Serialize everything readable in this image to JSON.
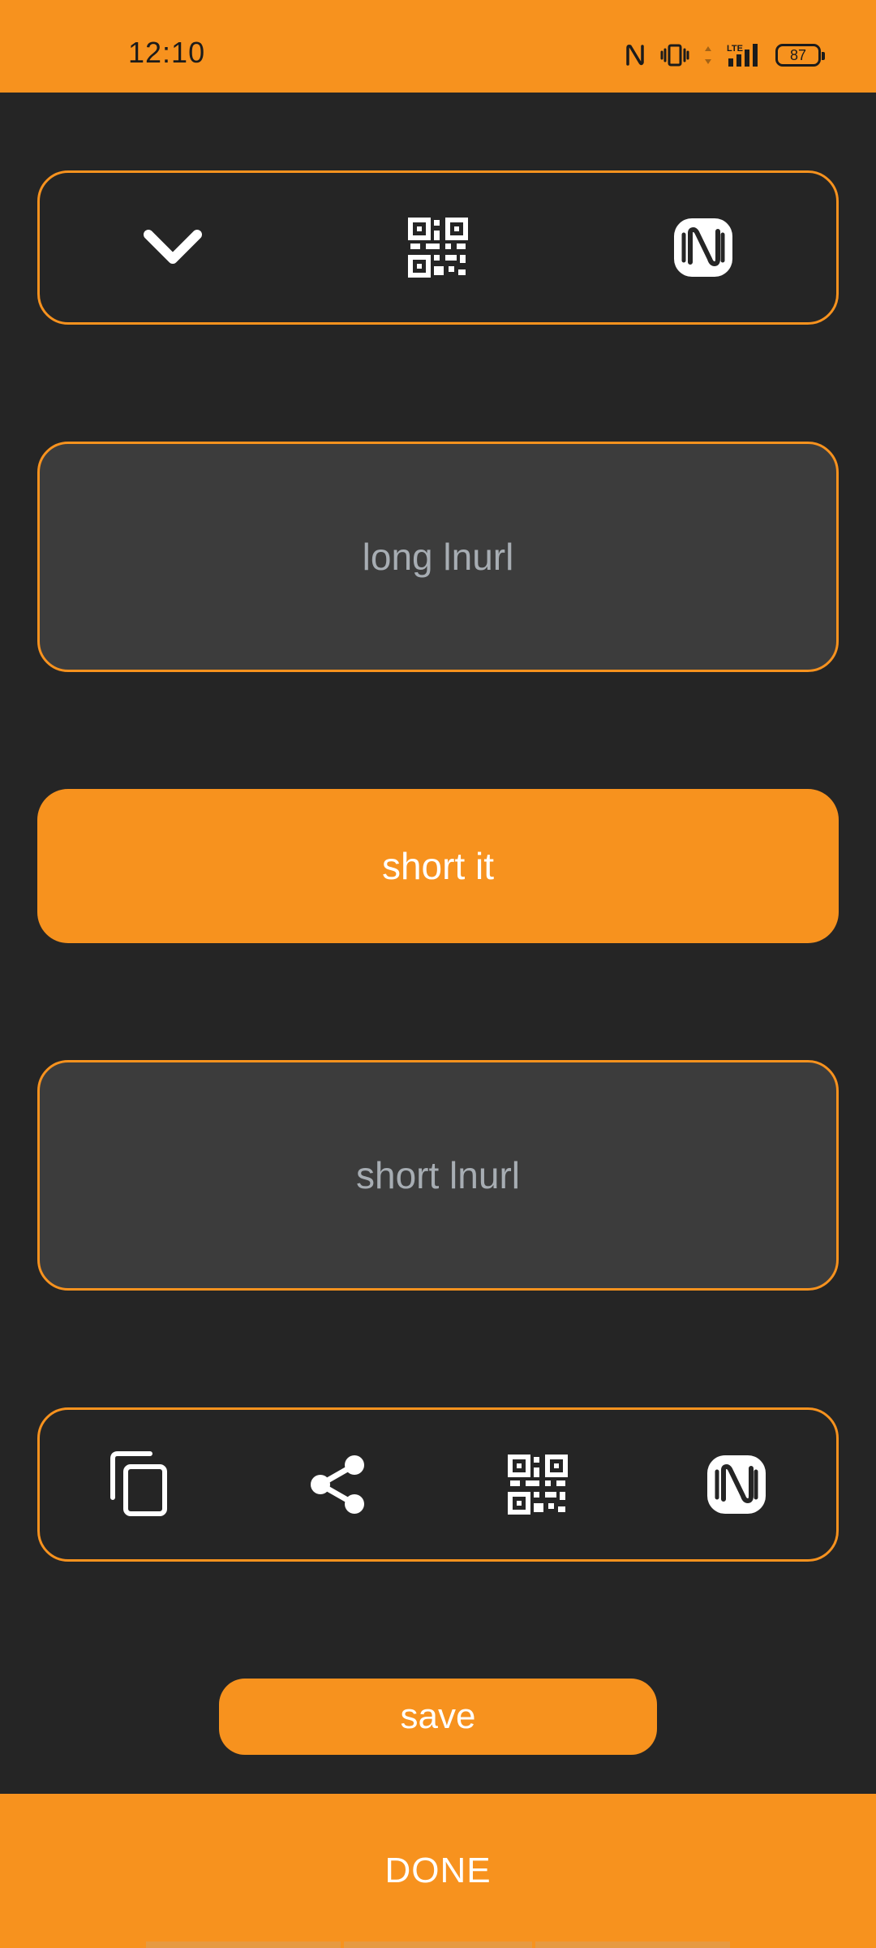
{
  "status_bar": {
    "time": "12:10",
    "battery": "87",
    "icons": [
      "nfc-icon",
      "vibrate-icon",
      "data-arrows-icon",
      "lte-signal-icon",
      "battery-icon"
    ]
  },
  "top_toolbar": {
    "icons": [
      "chevron-down-icon",
      "qr-code-icon",
      "nfc-icon"
    ]
  },
  "long_lnurl": {
    "placeholder": "long lnurl"
  },
  "short_it_button": {
    "label": "short it"
  },
  "short_lnurl": {
    "placeholder": "short lnurl"
  },
  "bottom_toolbar": {
    "icons": [
      "copy-icon",
      "share-icon",
      "qr-code-icon",
      "nfc-icon"
    ]
  },
  "save_button": {
    "label": "save"
  },
  "done_button": {
    "label": "DONE"
  },
  "colors": {
    "accent": "#F7921E",
    "background": "#252525",
    "field": "#3C3C3C",
    "placeholder_text": "#A7ADB3"
  }
}
